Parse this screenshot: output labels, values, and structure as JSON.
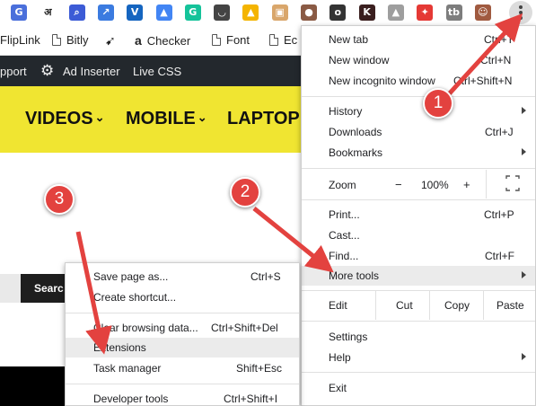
{
  "extensions": [
    {
      "name": "google-translate-icon",
      "glyph": "G",
      "color": "#4a6fdb"
    },
    {
      "name": "hindi-input-icon",
      "glyph": "अ",
      "color": "#ffffff",
      "text": "#222"
    },
    {
      "name": "search-ext-icon",
      "glyph": "⌕",
      "color": "#3c5bd6"
    },
    {
      "name": "trend-ext-icon",
      "glyph": "↗",
      "color": "#3b7be0"
    },
    {
      "name": "vivaldi-ext-icon",
      "glyph": "V",
      "color": "#1565c0"
    },
    {
      "name": "chart-ext-icon",
      "glyph": "▲",
      "color": "#4285f4"
    },
    {
      "name": "grammarly-icon",
      "glyph": "G",
      "color": "#15c39a"
    },
    {
      "name": "pocket-icon",
      "glyph": "◡",
      "color": "#444"
    },
    {
      "name": "drive-icon",
      "glyph": "▲",
      "color": "#f4b400"
    },
    {
      "name": "toggl-icon",
      "glyph": "▣",
      "color": "#d9a66b"
    },
    {
      "name": "coconut-icon",
      "glyph": "●",
      "color": "#8a5a44"
    },
    {
      "name": "screenshot-ext-icon",
      "glyph": "o",
      "color": "#333"
    },
    {
      "name": "k-ext-icon",
      "glyph": "K",
      "color": "#3a1f1f"
    },
    {
      "name": "mountain-ext-icon",
      "glyph": "▲",
      "color": "#9e9e9e"
    },
    {
      "name": "pin-ext-icon",
      "glyph": "✦",
      "color": "#e53935"
    },
    {
      "name": "tb-ext-icon",
      "glyph": "tb",
      "color": "#7d7d7d"
    },
    {
      "name": "profile-avatar-icon",
      "glyph": "☺",
      "color": "#a05a40"
    }
  ],
  "bookmarks": [
    {
      "label": "FlipLink"
    },
    {
      "label": "Bitly"
    },
    {
      "label": ""
    },
    {
      "label": "Checker"
    },
    {
      "label": "Font"
    },
    {
      "label": "Ec"
    }
  ],
  "wp_bar": {
    "items": [
      "pport",
      "Ad Inserter",
      "Live CSS"
    ]
  },
  "site_nav": {
    "items": [
      "VIDEOS",
      "MOBILE",
      "LAPTOP"
    ]
  },
  "search_button": "Searc",
  "chrome_menu": {
    "new_tab": {
      "label": "New tab",
      "shortcut": "Ctrl+T"
    },
    "new_window": {
      "label": "New window",
      "shortcut": "Ctrl+N"
    },
    "new_incognito": {
      "label": "New incognito window",
      "shortcut": "Ctrl+Shift+N"
    },
    "history": {
      "label": "History"
    },
    "downloads": {
      "label": "Downloads",
      "shortcut": "Ctrl+J"
    },
    "bookmarks": {
      "label": "Bookmarks"
    },
    "zoom": {
      "label": "Zoom",
      "minus": "−",
      "level": "100%",
      "plus": "+"
    },
    "print": {
      "label": "Print...",
      "shortcut": "Ctrl+P"
    },
    "cast": {
      "label": "Cast..."
    },
    "find": {
      "label": "Find...",
      "shortcut": "Ctrl+F"
    },
    "more_tools": {
      "label": "More tools"
    },
    "edit": {
      "label": "Edit",
      "cut": "Cut",
      "copy": "Copy",
      "paste": "Paste"
    },
    "settings": {
      "label": "Settings"
    },
    "help": {
      "label": "Help"
    },
    "exit": {
      "label": "Exit"
    }
  },
  "submenu": {
    "save_page": {
      "label": "Save page as...",
      "shortcut": "Ctrl+S"
    },
    "create_shortcut": {
      "label": "Create shortcut..."
    },
    "clear_data": {
      "label": "Clear browsing data...",
      "shortcut": "Ctrl+Shift+Del"
    },
    "extensions": {
      "label": "Extensions"
    },
    "task_manager": {
      "label": "Task manager",
      "shortcut": "Shift+Esc"
    },
    "dev_tools": {
      "label": "Developer tools",
      "shortcut": "Ctrl+Shift+I"
    }
  },
  "annotations": {
    "one": "1",
    "two": "2",
    "three": "3"
  },
  "colors": {
    "accent_yellow": "#f0e531",
    "annotation_red": "#e3423f",
    "wp_dark": "#23282d"
  }
}
